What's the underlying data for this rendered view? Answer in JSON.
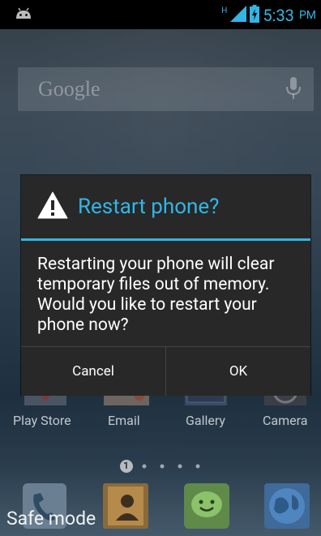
{
  "status_bar": {
    "time": "5:33",
    "ampm": "PM",
    "network_type": "H"
  },
  "search": {
    "placeholder": "Google"
  },
  "dialog": {
    "title": "Restart phone?",
    "message": "Restarting your phone will clear temporary files out of memory. Would you like to restart your phone now?",
    "cancel_label": "Cancel",
    "ok_label": "OK"
  },
  "apps": [
    {
      "label": "Play Store",
      "icon": "play-store-icon"
    },
    {
      "label": "Email",
      "icon": "email-icon"
    },
    {
      "label": "Gallery",
      "icon": "gallery-icon"
    },
    {
      "label": "Camera",
      "icon": "camera-icon"
    }
  ],
  "page_indicator": {
    "current": "1",
    "total_dots": 5
  },
  "dock": [
    {
      "icon": "phone-icon"
    },
    {
      "icon": "contacts-icon"
    },
    {
      "icon": "messaging-icon"
    },
    {
      "icon": "browser-icon"
    }
  ],
  "safe_mode_label": "Safe mode",
  "colors": {
    "accent": "#33b5e5",
    "dialog_bg": "#282828"
  }
}
